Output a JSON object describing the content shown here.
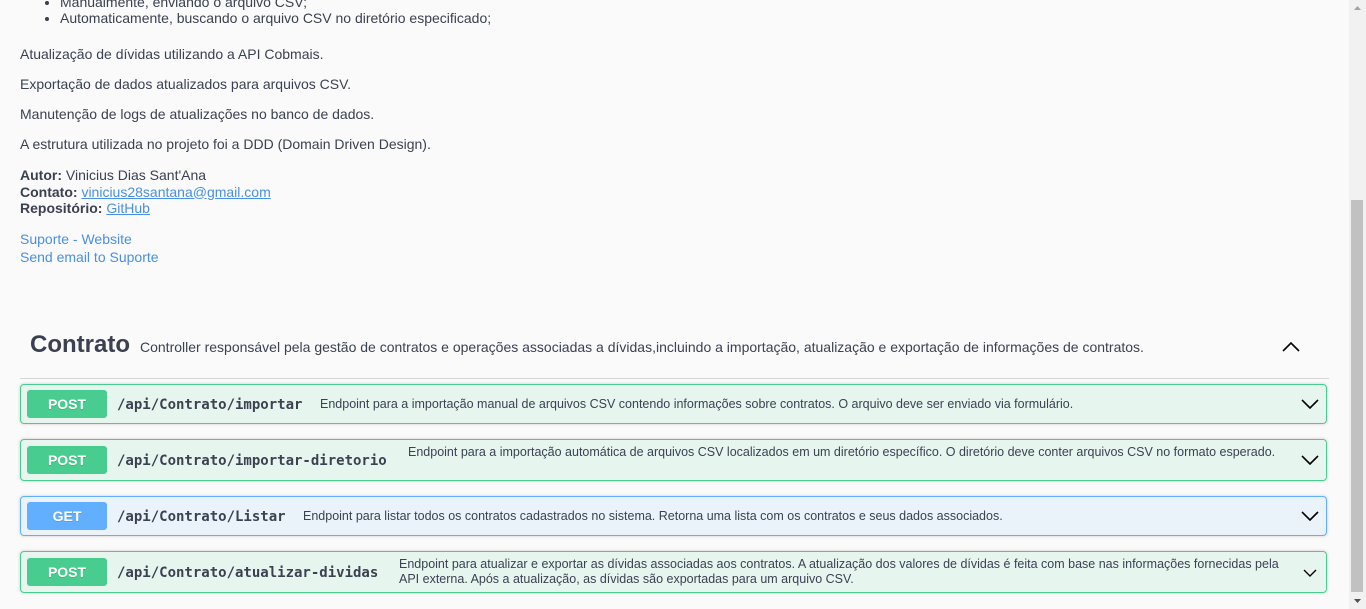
{
  "info": {
    "bullets": [
      "Manualmente, enviando o arquivo CSV;",
      "Automaticamente, buscando o arquivo CSV no diretório especificado;"
    ],
    "paragraphs": [
      "Atualização de dívidas utilizando a API Cobmais.",
      "Exportação de dados atualizados para arquivos CSV.",
      "Manutenção de logs de atualizações no banco de dados.",
      "A estrutura utilizada no projeto foi a DDD (Domain Driven Design)."
    ],
    "author_label": "Autor:",
    "author_value": "Vinicius Dias Sant'Ana",
    "contact_label": "Contato:",
    "contact_value": "vinicius28santana@gmail.com",
    "repo_label": "Repositório:",
    "repo_value": "GitHub",
    "support_website": "Suporte - Website",
    "support_email": "Send email to Suporte"
  },
  "tag": {
    "name": "Contrato",
    "description": "Controller responsável pela gestão de contratos e operações associadas a dívidas,incluindo a importação, atualização e exportação de informações de contratos."
  },
  "operations": [
    {
      "method": "POST",
      "path": "/api/Contrato/importar",
      "summary": "Endpoint para a importação manual de arquivos CSV contendo informações sobre contratos. O arquivo deve ser enviado via formulário."
    },
    {
      "method": "POST",
      "path": "/api/Contrato/importar-diretorio",
      "summary": "Endpoint para a importação automática de arquivos CSV localizados em um diretório específico. O diretório deve conter arquivos CSV no formato esperado."
    },
    {
      "method": "GET",
      "path": "/api/Contrato/Listar",
      "summary": "Endpoint para listar todos os contratos cadastrados no sistema. Retorna uma lista com os contratos e seus dados associados."
    },
    {
      "method": "POST",
      "path": "/api/Contrato/atualizar-dividas",
      "summary": "Endpoint para atualizar e exportar as dívidas associadas aos contratos. A atualização dos valores de dívidas é feita com base nas informações fornecidas pela API externa. Após a atualização, as dívidas são exportadas para um arquivo CSV."
    }
  ],
  "colors": {
    "post": "#49cc90",
    "get": "#61affe",
    "link": "#4990e2",
    "text": "#3b4151"
  },
  "icons": {
    "tag_toggle": "chevron-up-icon",
    "operation_toggle": "chevron-down-icon"
  }
}
